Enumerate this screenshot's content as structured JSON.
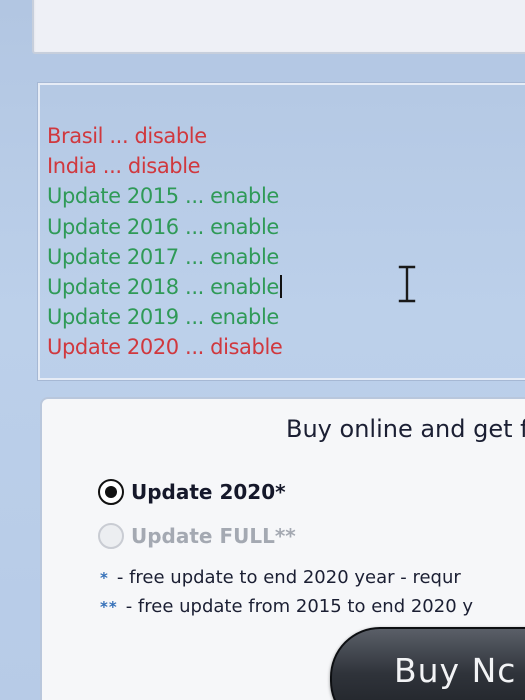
{
  "update_log": {
    "lines": [
      {
        "text": "Brasil ... disable",
        "status": "disable"
      },
      {
        "text": "India ... disable",
        "status": "disable"
      },
      {
        "text": "Update 2015 ... enable",
        "status": "enable"
      },
      {
        "text": "Update 2016 ... enable",
        "status": "enable"
      },
      {
        "text": "Update 2017 ... enable",
        "status": "enable"
      },
      {
        "text": "Update 2018 ... enable",
        "status": "enable"
      },
      {
        "text": "Update 2019 ... enable",
        "status": "enable"
      },
      {
        "text": "Update 2020 ... disable",
        "status": "disable"
      }
    ],
    "colors": {
      "enable": "#2f9a57",
      "disable": "#d0383e"
    }
  },
  "purchase": {
    "heading": "Buy online and get f",
    "options": [
      {
        "label": "Update 2020*",
        "selected": true,
        "enabled": true
      },
      {
        "label": "Update FULL**",
        "selected": false,
        "enabled": false
      }
    ],
    "notes": [
      {
        "mark": "*",
        "text": "- free update to end 2020 year - requr"
      },
      {
        "mark": "**",
        "text": "- free update from 2015 to end 2020 y"
      }
    ],
    "buy_button_label": "Buy Nc"
  },
  "icons": {
    "cursor": "i-beam-cursor-icon"
  },
  "colors": {
    "background": "#b9cce6",
    "panel": "#f6f7f9",
    "note_mark": "#3570b8",
    "button": "#2f333a"
  }
}
